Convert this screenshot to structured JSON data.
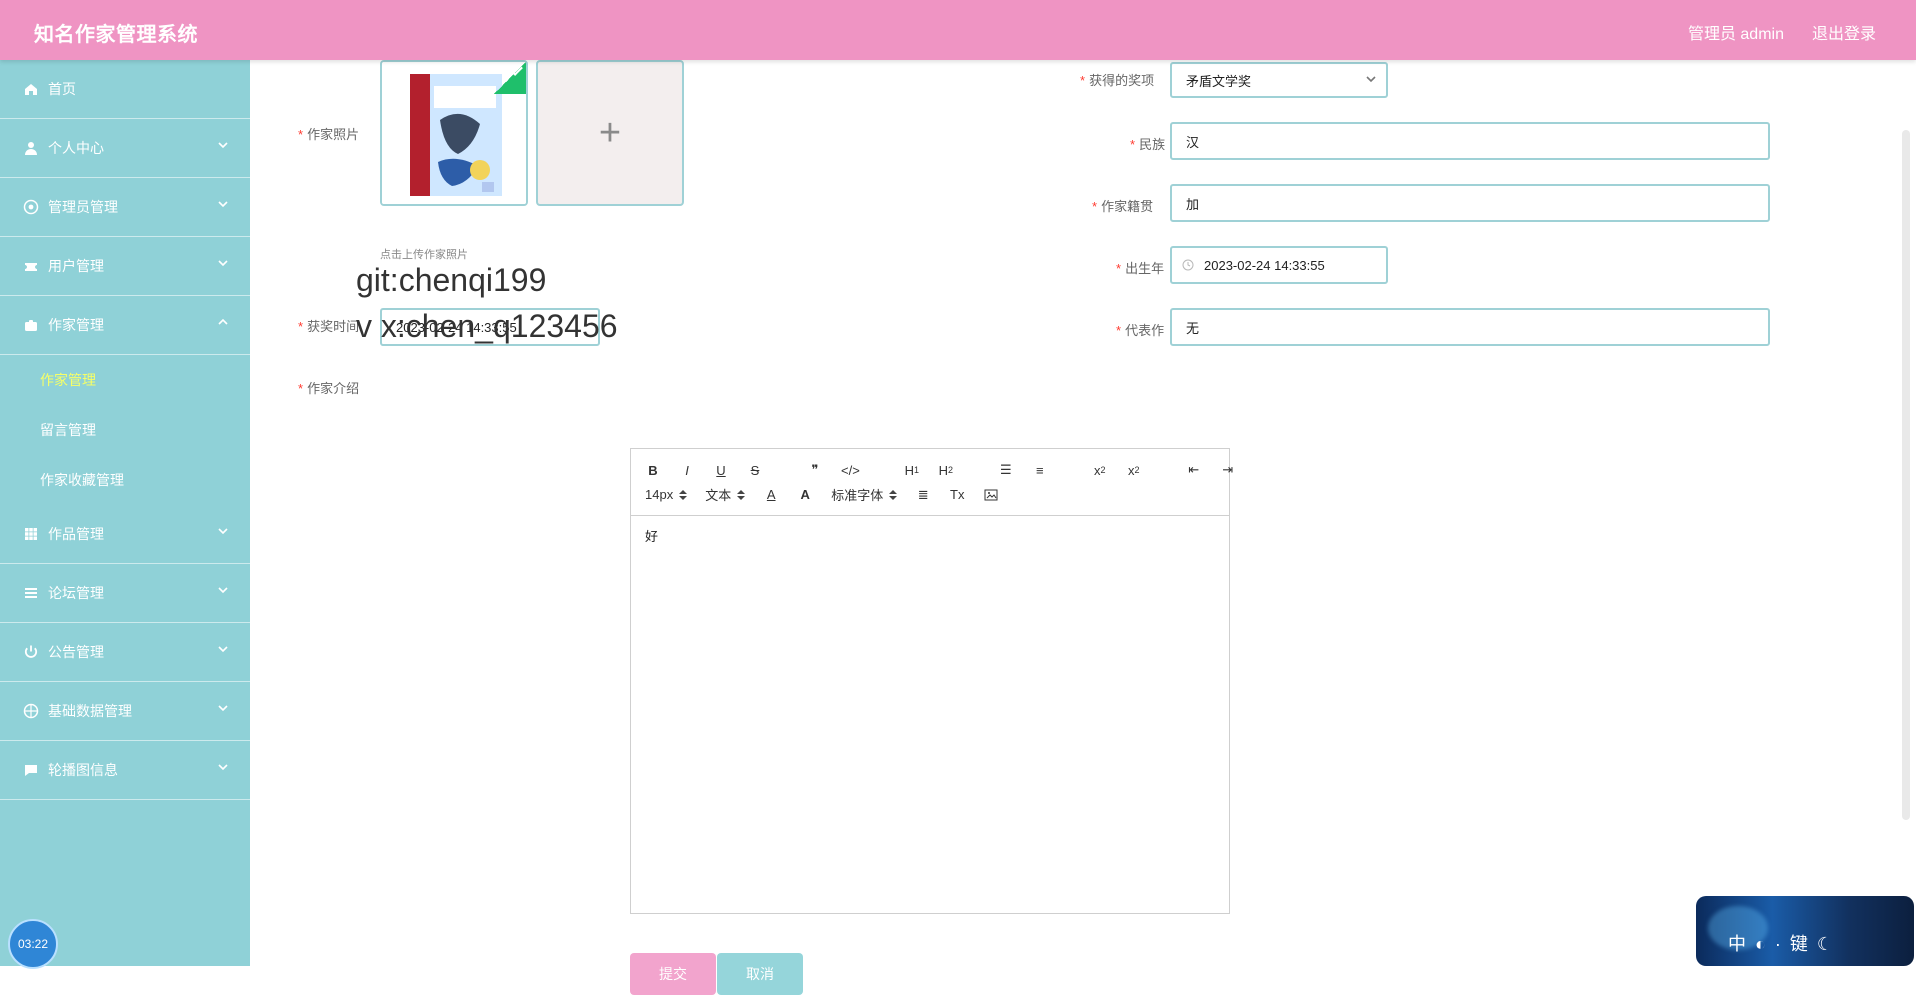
{
  "app": {
    "title": "知名作家管理系统",
    "user_label": "管理员 admin",
    "logout_label": "退出登录"
  },
  "sidebar": {
    "items": [
      {
        "label": "首页",
        "icon": "home-icon"
      },
      {
        "label": "个人中心",
        "icon": "user-icon"
      },
      {
        "label": "管理员管理",
        "icon": "admin-icon"
      },
      {
        "label": "用户管理",
        "icon": "users-icon"
      },
      {
        "label": "作家管理",
        "icon": "briefcase-icon",
        "expanded": true,
        "children": [
          {
            "label": "作家管理",
            "active": true
          },
          {
            "label": "留言管理"
          },
          {
            "label": "作家收藏管理"
          }
        ]
      },
      {
        "label": "作品管理",
        "icon": "grid-icon"
      },
      {
        "label": "论坛管理",
        "icon": "list-icon"
      },
      {
        "label": "公告管理",
        "icon": "power-icon"
      },
      {
        "label": "基础数据管理",
        "icon": "settings-icon"
      },
      {
        "label": "轮播图信息",
        "icon": "comment-icon"
      }
    ]
  },
  "form": {
    "photo_label": "作家照片",
    "photo_hint": "点击上传作家照片",
    "award_time_label": "获奖时间",
    "award_time_value": "2023-02-24 14:33:55",
    "intro_label": "作家介绍",
    "intro_value": "好",
    "award_label": "获得的奖项",
    "award_value": "矛盾文学奖",
    "ethnicity_label": "民族",
    "ethnicity_value": "汉",
    "origin_label": "作家籍贯",
    "origin_value": "加",
    "birth_label": "出生年",
    "birth_value": "2023-02-24 14:33:55",
    "works_label": "代表作",
    "works_value": "无",
    "submit_label": "提交",
    "cancel_label": "取消",
    "overlay_1": "git:chenqi199",
    "overlay_2": "v x:chen_q123456"
  },
  "editor_toolbar": {
    "font_size": "14px",
    "text_type": "文本",
    "font_family": "标准字体"
  },
  "status": {
    "clock": "03:22",
    "banner_text": "中 ◐ · 键 ☾"
  }
}
